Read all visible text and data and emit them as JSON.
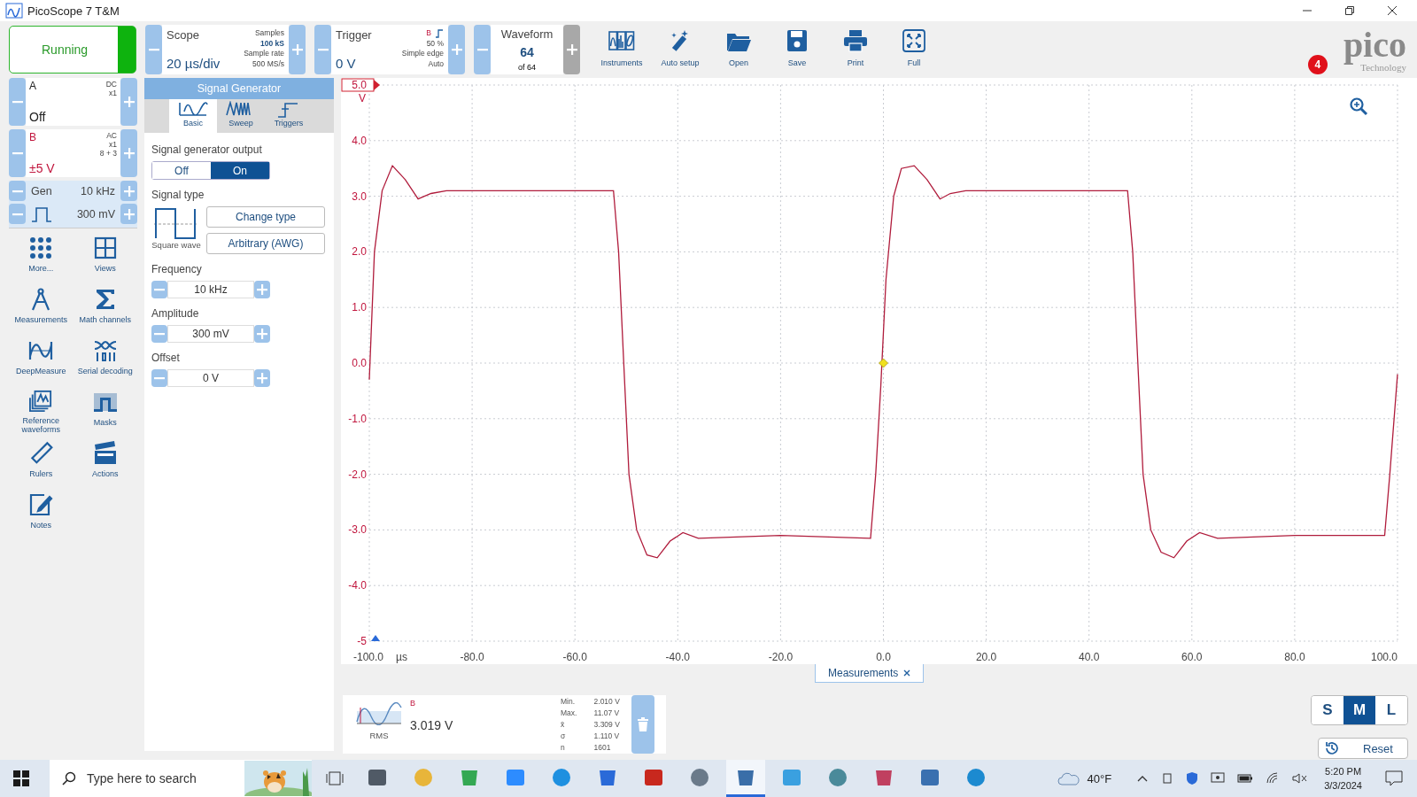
{
  "window": {
    "title": "PicoScope 7 T&M"
  },
  "toolbar": {
    "run": {
      "label": "Running",
      "on": true
    },
    "scope": {
      "title": "Scope",
      "value": "20 µs/div",
      "samples_label": "Samples",
      "samples": "100 kS",
      "rate_label": "Sample rate",
      "rate": "500 MS/s"
    },
    "trigger": {
      "title": "Trigger",
      "value": "0 V",
      "channel": "B",
      "percent": "50 %",
      "type": "Simple edge",
      "mode": "Auto"
    },
    "waveform": {
      "title": "Waveform",
      "value": "64",
      "total": "of 64"
    },
    "tools": [
      {
        "label": "Instruments"
      },
      {
        "label": "Auto setup"
      },
      {
        "label": "Open"
      },
      {
        "label": "Save"
      },
      {
        "label": "Print"
      },
      {
        "label": "Full"
      }
    ],
    "notification_count": "4",
    "logo": {
      "name": "pico",
      "tagline": "Technology"
    }
  },
  "channels": [
    {
      "name": "A",
      "coupling": "DC",
      "probe": "x1",
      "range": "Off",
      "color": "#222222"
    },
    {
      "name": "B",
      "coupling": "AC",
      "probe": "x1",
      "resolution": "8 + 3",
      "range": "±5 V",
      "color": "#c0143c"
    }
  ],
  "generator": {
    "label": "Gen",
    "frequency": "10 kHz",
    "amplitude": "300 mV"
  },
  "side_tools": [
    {
      "label": "More..."
    },
    {
      "label": "Views"
    },
    {
      "label": "Measurements"
    },
    {
      "label": "Math channels"
    },
    {
      "label": "DeepMeasure"
    },
    {
      "label": "Serial decoding"
    },
    {
      "label": "Reference waveforms"
    },
    {
      "label": "Masks"
    },
    {
      "label": "Rulers"
    },
    {
      "label": "Actions"
    },
    {
      "label": "Notes"
    }
  ],
  "signal_generator": {
    "title": "Signal Generator",
    "tabs": [
      {
        "label": "Basic",
        "selected": true
      },
      {
        "label": "Sweep",
        "selected": false
      },
      {
        "label": "Triggers",
        "selected": false
      }
    ],
    "output_label": "Signal generator output",
    "output_options": [
      {
        "label": "Off",
        "selected": false
      },
      {
        "label": "On",
        "selected": true
      }
    ],
    "type_label": "Signal type",
    "type_name": "Square wave",
    "type_buttons": [
      "Change type",
      "Arbitrary (AWG)"
    ],
    "fields": [
      {
        "label": "Frequency",
        "value": "10 kHz"
      },
      {
        "label": "Amplitude",
        "value": "300 mV"
      },
      {
        "label": "Offset",
        "value": "0 V"
      }
    ]
  },
  "plot": {
    "chart_data": {
      "type": "line",
      "xlabel": "µs",
      "ylabel": "V",
      "xlim": [
        -100,
        100
      ],
      "ylim": [
        -5,
        5
      ],
      "xticks": [
        {
          "value": -100,
          "label": "-100.0"
        },
        {
          "value": -80,
          "label": "-80.0"
        },
        {
          "value": -60,
          "label": "-60.0"
        },
        {
          "value": -40,
          "label": "-40.0"
        },
        {
          "value": -20,
          "label": "-20.0"
        },
        {
          "value": 0,
          "label": "0.0"
        },
        {
          "value": 20,
          "label": "20.0"
        },
        {
          "value": 40,
          "label": "40.0"
        },
        {
          "value": 60,
          "label": "60.0"
        },
        {
          "value": 80,
          "label": "80.0"
        },
        {
          "value": 100,
          "label": "100.0"
        }
      ],
      "yticks": [
        {
          "value": 5,
          "label": "5.0"
        },
        {
          "value": 4,
          "label": "4.0"
        },
        {
          "value": 3,
          "label": "3.0"
        },
        {
          "value": 2,
          "label": "2.0"
        },
        {
          "value": 1,
          "label": "1.0"
        },
        {
          "value": 0,
          "label": "0.0"
        },
        {
          "value": -1,
          "label": "-1.0"
        },
        {
          "value": -2,
          "label": "-2.0"
        },
        {
          "value": -3,
          "label": "-3.0"
        },
        {
          "value": -4,
          "label": "-4.0"
        },
        {
          "value": -5,
          "label": "-5"
        }
      ],
      "x": [
        -100,
        -99,
        -97.5,
        -95.5,
        -93,
        -90.5,
        -88,
        -85,
        -70,
        -52.5,
        -51.5,
        -50.5,
        -49.5,
        -48,
        -46,
        -44,
        -41.5,
        -39,
        -36,
        -20,
        -2.5,
        -1.5,
        -0.5,
        0.5,
        2,
        3.5,
        6,
        8.5,
        11,
        13,
        16,
        30,
        47.5,
        48.5,
        49.5,
        50.5,
        52,
        54,
        56.5,
        59,
        61.5,
        65,
        80,
        97.5,
        98.5,
        99.5,
        100
      ],
      "grid": true,
      "series": [
        {
          "color": "#b01c3c",
          "values": [
            -0.3,
            2.0,
            3.1,
            3.55,
            3.3,
            2.95,
            3.05,
            3.1,
            3.1,
            3.1,
            2.0,
            0.0,
            -2.0,
            -3.0,
            -3.45,
            -3.5,
            -3.2,
            -3.05,
            -3.15,
            -3.1,
            -3.15,
            -2.0,
            -0.4,
            1.5,
            3.0,
            3.5,
            3.55,
            3.3,
            2.95,
            3.05,
            3.1,
            3.1,
            3.1,
            2.0,
            0.0,
            -2.0,
            -3.0,
            -3.4,
            -3.5,
            -3.2,
            -3.05,
            -3.15,
            -3.1,
            -3.1,
            -2.0,
            -0.8,
            -0.2
          ]
        }
      ]
    },
    "measurements_tab": "Measurements"
  },
  "measurement": {
    "channel": "B",
    "name": "RMS",
    "value": "3.019 V",
    "stats": [
      {
        "label": "Min.",
        "value": "2.010 V"
      },
      {
        "label": "Max.",
        "value": "11.07 V"
      },
      {
        "label": "x̄",
        "value": "3.309 V"
      },
      {
        "label": "σ",
        "value": "1.110 V"
      },
      {
        "label": "n",
        "value": "1601"
      }
    ]
  },
  "size_options": [
    {
      "label": "S",
      "selected": false
    },
    {
      "label": "M",
      "selected": true
    },
    {
      "label": "L",
      "selected": false
    }
  ],
  "reset": "Reset",
  "taskbar": {
    "search_placeholder": "Type here to search",
    "weather": "40°F",
    "time": "5:20 PM",
    "date": "3/3/2024",
    "apps": [
      {
        "color": "#505a66",
        "selected": false
      },
      {
        "color": "#e8b53a",
        "selected": false
      },
      {
        "color": "#34a853",
        "selected": false
      },
      {
        "color": "#2d8cff",
        "selected": false
      },
      {
        "color": "#1e90e0",
        "selected": false
      },
      {
        "color": "#2a6ad8",
        "selected": false
      },
      {
        "color": "#c8281e",
        "selected": false
      },
      {
        "color": "#6a7a8a",
        "selected": false
      },
      {
        "color": "#3a6ea8",
        "selected": true
      },
      {
        "color": "#3aa0e0",
        "selected": false
      },
      {
        "color": "#4a8a9a",
        "selected": false
      },
      {
        "color": "#c04060",
        "selected": false
      },
      {
        "color": "#3a70b0",
        "selected": false
      },
      {
        "color": "#1c8ad0",
        "selected": false
      }
    ]
  }
}
